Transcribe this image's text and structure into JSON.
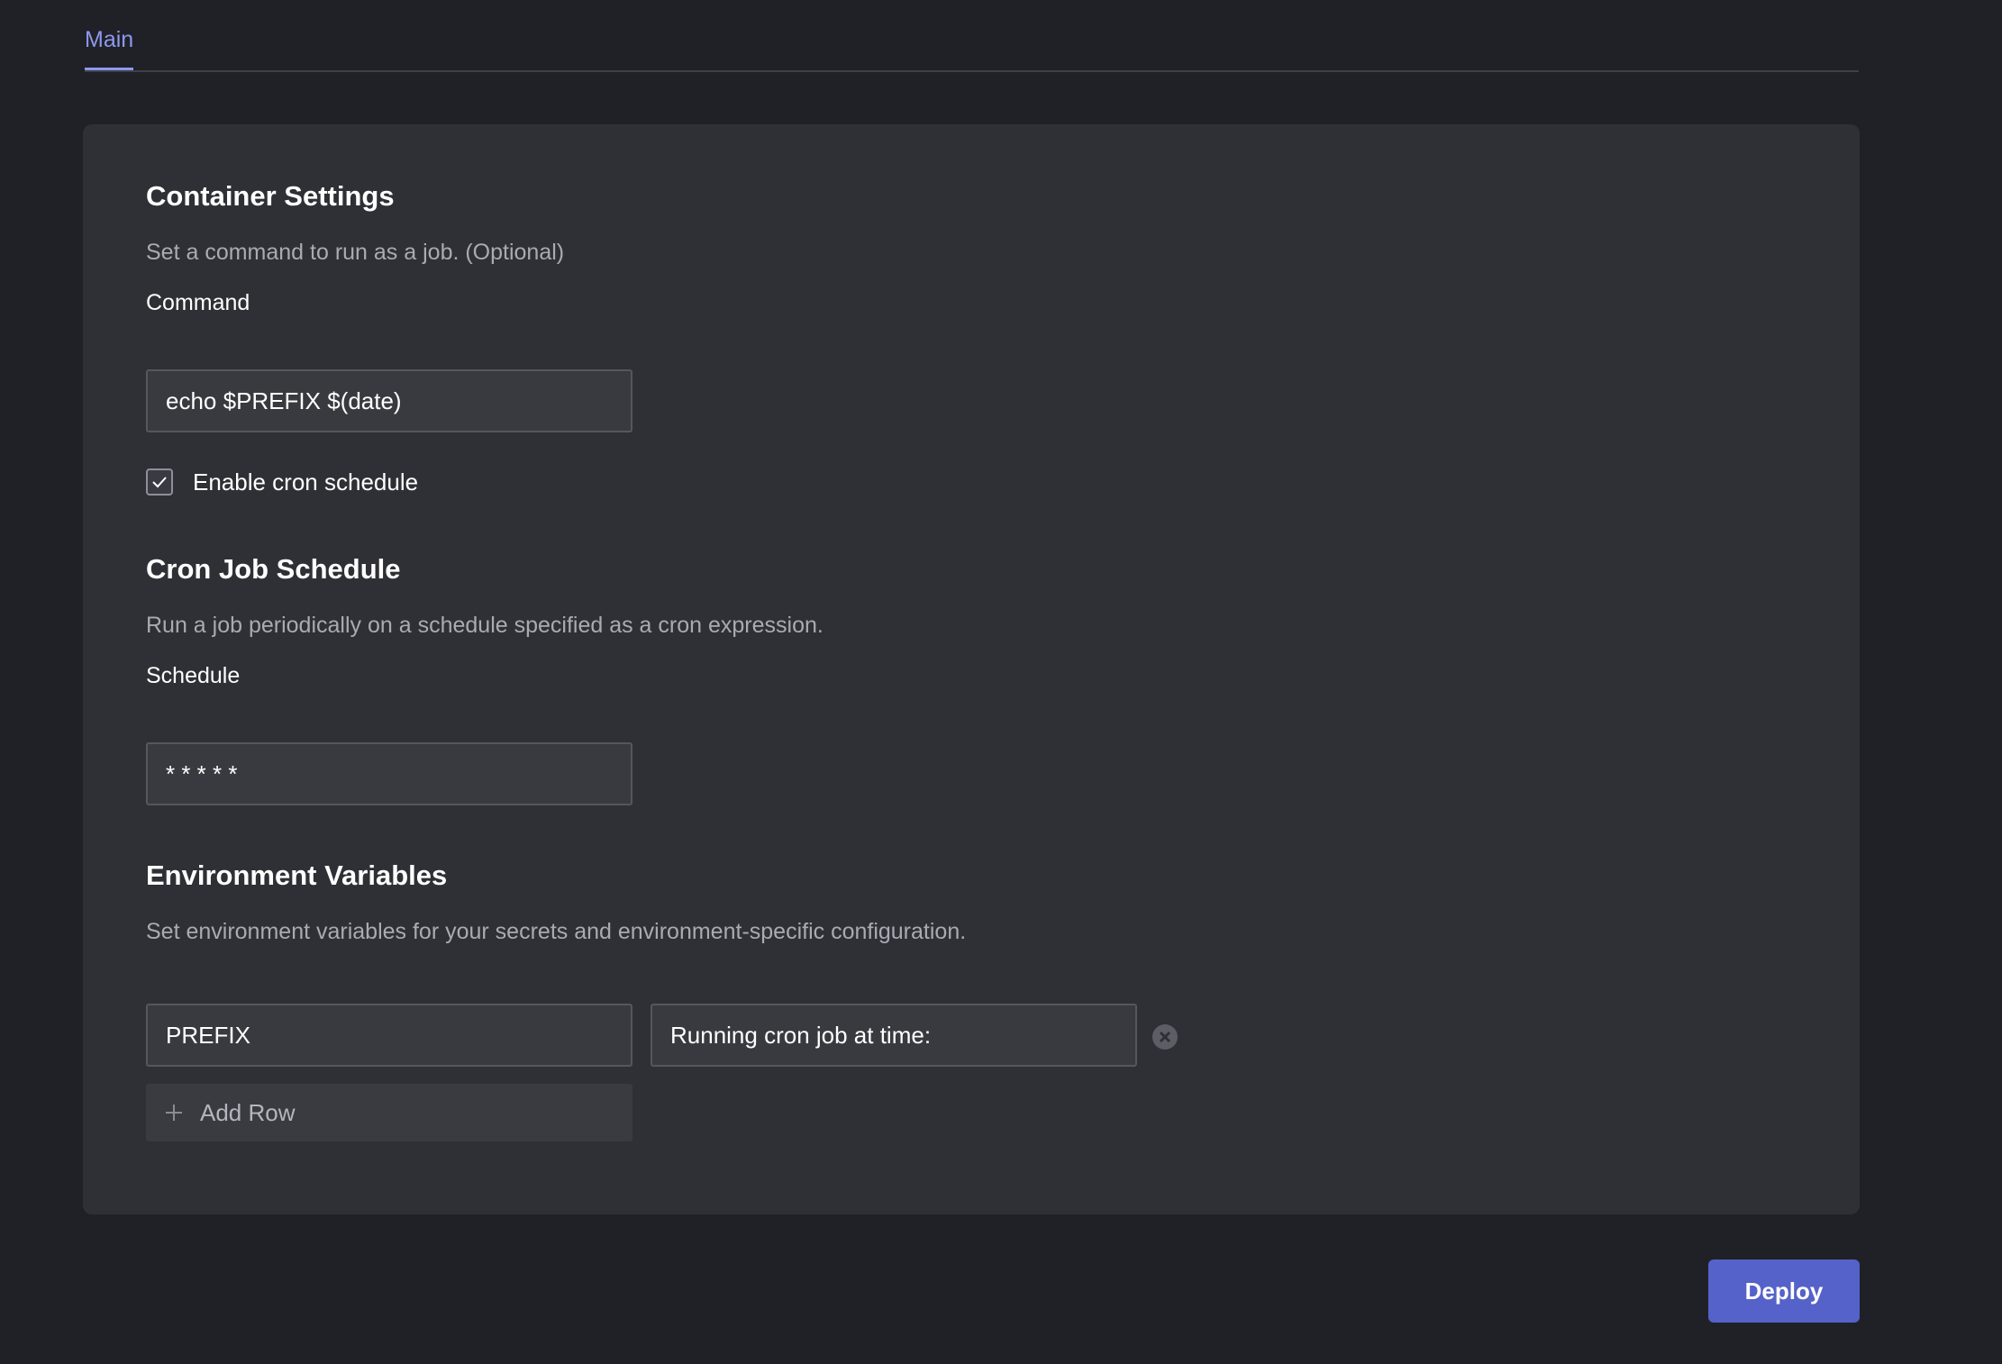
{
  "tabs": [
    {
      "label": "Main",
      "active": true
    }
  ],
  "container_settings": {
    "heading": "Container Settings",
    "description": "Set a command to run as a job. (Optional)",
    "command_label": "Command",
    "command_value": "echo $PREFIX $(date)",
    "cron_checkbox_label": "Enable cron schedule",
    "cron_checkbox_checked": true
  },
  "cron_schedule": {
    "heading": "Cron Job Schedule",
    "description": "Run a job periodically on a schedule specified as a cron expression.",
    "schedule_label": "Schedule",
    "schedule_value": "* * * * *"
  },
  "env_vars": {
    "heading": "Environment Variables",
    "description": "Set environment variables for your secrets and environment-specific configuration.",
    "rows": [
      {
        "key": "PREFIX",
        "value": "Running cron job at time:"
      }
    ],
    "add_row_label": "Add Row",
    "remove_icon": "close-circle-icon",
    "add_icon": "plus-icon"
  },
  "actions": {
    "deploy_label": "Deploy"
  },
  "colors": {
    "page_bg": "#202126",
    "card_bg": "#2f3035",
    "accent": "#8f97f0",
    "deploy_bg": "#5562c9"
  }
}
